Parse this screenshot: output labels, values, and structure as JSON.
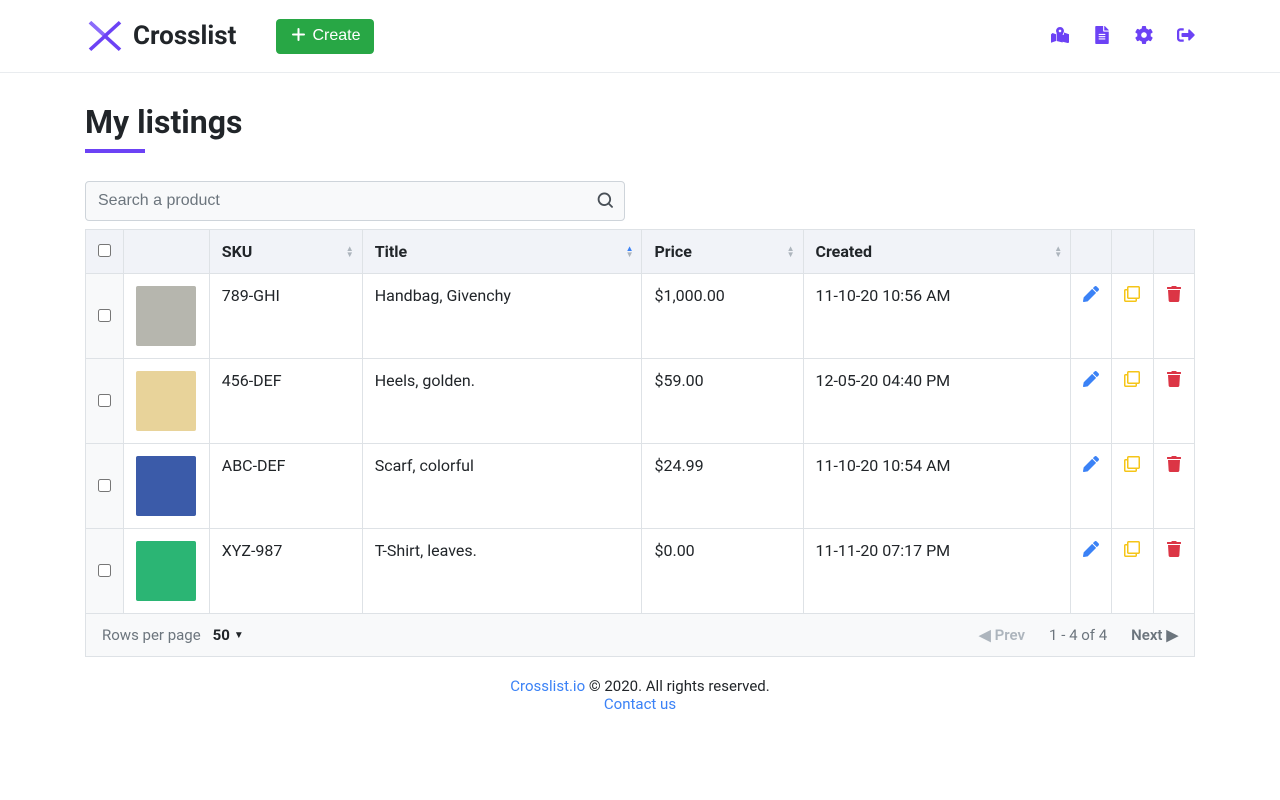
{
  "brand": {
    "name": "Crosslist"
  },
  "header": {
    "create_label": "Create"
  },
  "page": {
    "title": "My listings"
  },
  "search": {
    "placeholder": "Search a product"
  },
  "columns": {
    "sku": "SKU",
    "title": "Title",
    "price": "Price",
    "created": "Created"
  },
  "rows": [
    {
      "sku": "789-GHI",
      "title": "Handbag, Givenchy",
      "price": "$1,000.00",
      "created": "11-10-20 10:56 AM",
      "thumb": "#b6b6ae"
    },
    {
      "sku": "456-DEF",
      "title": "Heels, golden.",
      "price": "$59.00",
      "created": "12-05-20 04:40 PM",
      "thumb": "#e8d39a"
    },
    {
      "sku": "ABC-DEF",
      "title": "Scarf, colorful",
      "price": "$24.99",
      "created": "11-10-20 10:54 AM",
      "thumb": "#3b5ba9"
    },
    {
      "sku": "XYZ-987",
      "title": "T-Shirt, leaves.",
      "price": "$0.00",
      "created": "11-11-20 07:17 PM",
      "thumb": "#2bb574"
    }
  ],
  "pagination": {
    "rows_label": "Rows per page",
    "rows_value": "50",
    "range": "1 - 4 of 4",
    "prev": "Prev",
    "next": "Next"
  },
  "footer": {
    "site": "Crosslist.io",
    "copyright": " © 2020. All rights reserved.",
    "contact": "Contact us"
  }
}
